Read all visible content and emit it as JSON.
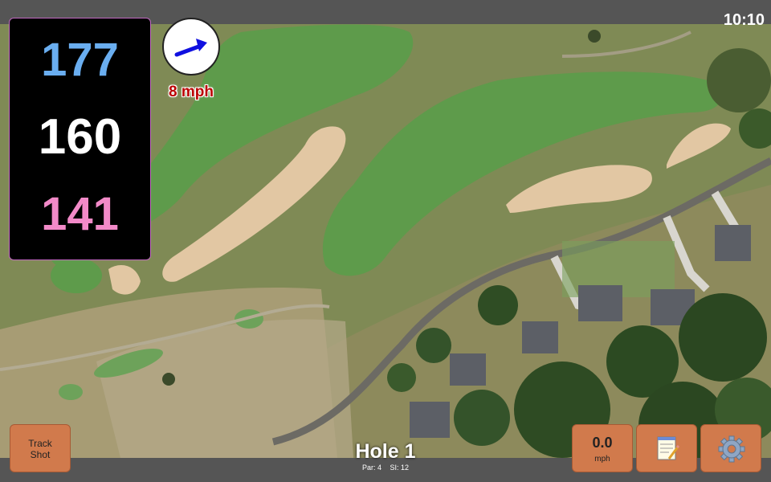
{
  "status": {
    "time": "10:10"
  },
  "distances": {
    "back": "177",
    "middle": "160",
    "front": "141"
  },
  "colors": {
    "back": "#6aaef0",
    "middle": "#ffffff",
    "front": "#f28ac8",
    "wind_text": "#b00000",
    "button": "#d17a4c"
  },
  "wind": {
    "speed": "8 mph",
    "icon": "wind-direction-arrow-icon"
  },
  "buttons": {
    "track_shot": "Track Shot",
    "wind_value": "0.0",
    "wind_unit": "mph",
    "notes_icon": "notepad-icon",
    "settings_icon": "gear-icon"
  },
  "hole": {
    "title": "Hole 1",
    "par": "Par: 4",
    "si": "SI: 12"
  }
}
